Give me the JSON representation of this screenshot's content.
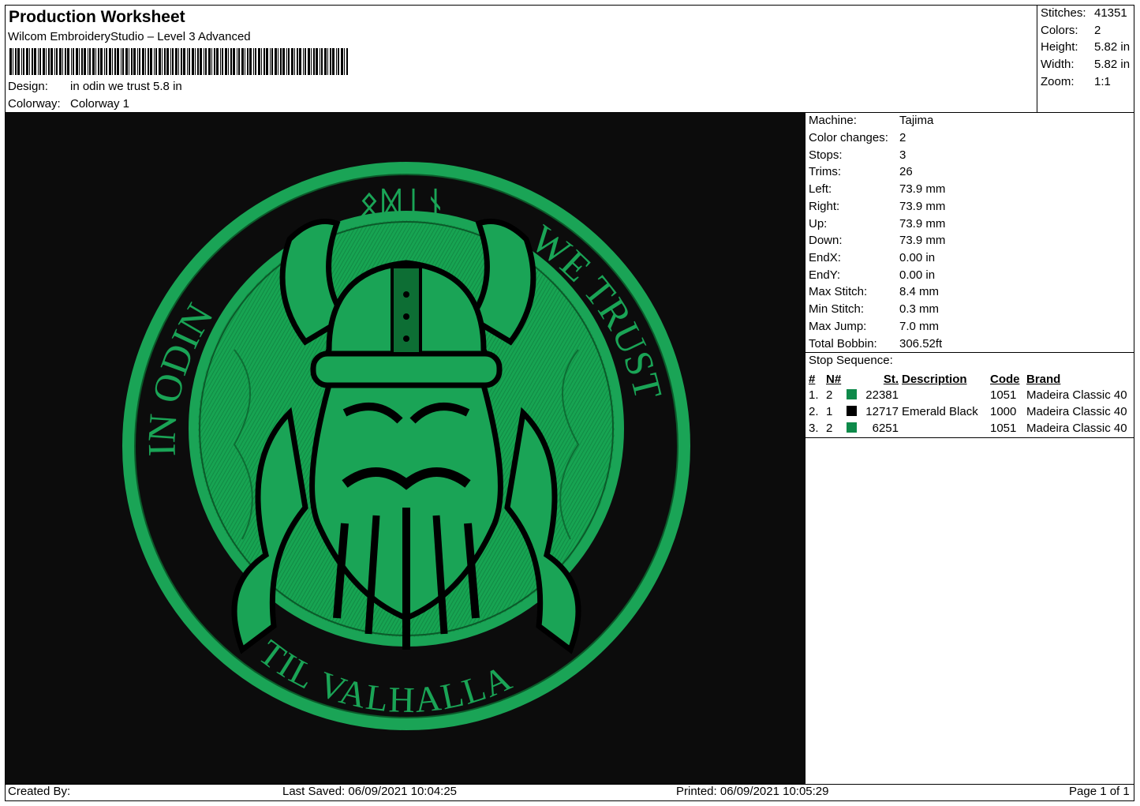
{
  "header": {
    "title": "Production Worksheet",
    "software": "Wilcom EmbroideryStudio – Level 3 Advanced",
    "design_label": "Design:",
    "design_value": "in odin we trust 5.8 in",
    "colorway_label": "Colorway:",
    "colorway_value": "Colorway 1"
  },
  "summary": [
    {
      "label": "Stitches:",
      "value": "41351"
    },
    {
      "label": "Colors:",
      "value": "2"
    },
    {
      "label": "Height:",
      "value": "5.82 in"
    },
    {
      "label": "Width:",
      "value": "5.82 in"
    },
    {
      "label": "Zoom:",
      "value": "1:1"
    }
  ],
  "machine_info": [
    {
      "label": "Machine:",
      "value": "Tajima"
    },
    {
      "label": "Color changes:",
      "value": "2"
    },
    {
      "label": "Stops:",
      "value": "3"
    },
    {
      "label": "Trims:",
      "value": "26"
    },
    {
      "label": "Left:",
      "value": "73.9 mm"
    },
    {
      "label": "Right:",
      "value": "73.9 mm"
    },
    {
      "label": "Up:",
      "value": "73.9 mm"
    },
    {
      "label": "Down:",
      "value": "73.9 mm"
    },
    {
      "label": "EndX:",
      "value": "0.00 in"
    },
    {
      "label": "EndY:",
      "value": "0.00 in"
    },
    {
      "label": "Max Stitch:",
      "value": "8.4 mm"
    },
    {
      "label": "Min Stitch:",
      "value": "0.3 mm"
    },
    {
      "label": "Max Jump:",
      "value": "7.0 mm"
    },
    {
      "label": "Total Bobbin:",
      "value": "306.52ft"
    }
  ],
  "stop_sequence": {
    "title": "Stop Sequence:",
    "headers": {
      "num": "#",
      "n": "N#",
      "st": "St.",
      "description": "Description",
      "code": "Code",
      "brand": "Brand"
    },
    "rows": [
      {
        "num": "1.",
        "n": "2",
        "color": "#0e8a4a",
        "st": "22381",
        "description": "",
        "code": "1051",
        "brand": "Madeira Classic 40"
      },
      {
        "num": "2.",
        "n": "1",
        "color": "#000000",
        "st": "12717",
        "description": "Emerald Black",
        "code": "1000",
        "brand": "Madeira Classic 40"
      },
      {
        "num": "3.",
        "n": "2",
        "color": "#0e8a4a",
        "st": "6251",
        "description": "",
        "code": "1051",
        "brand": "Madeira Classic 40"
      }
    ]
  },
  "design_text": {
    "runes": "ᛟᛞᛁᚾ",
    "left_arc": "IN ODIN",
    "right_arc": "WE TRUST",
    "bottom_arc": "TIL VALHALLA"
  },
  "colors": {
    "thread_green": "#17a452",
    "thread_dark_green": "#0d6e34",
    "background": "#0c0c0c"
  },
  "footer": {
    "created_by": "Created By:",
    "last_saved": "Last Saved: 06/09/2021 10:04:25",
    "printed": "Printed: 06/09/2021 10:05:29",
    "page": "Page 1 of 1"
  }
}
